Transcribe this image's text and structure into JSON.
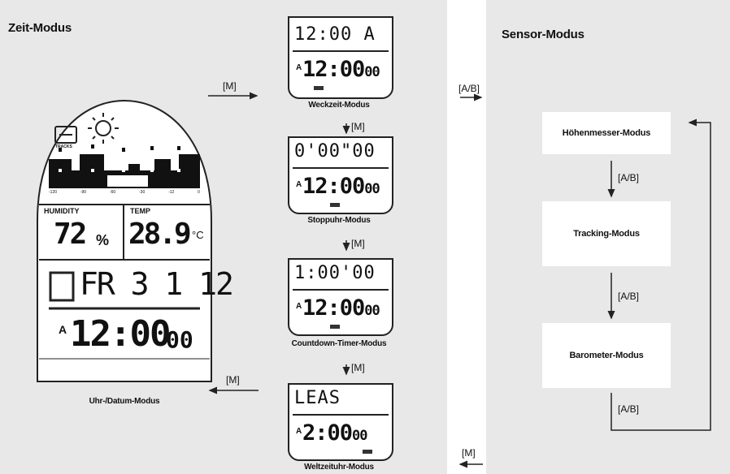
{
  "zeit": {
    "title": "Zeit-Modus",
    "main_caption": "Uhr-/Datum-Modus",
    "main_lcd": {
      "tracks_label": "TRACKS",
      "humidity_label": "HUMIDITY",
      "temp_label": "TEMP",
      "humidity_value": "72",
      "humidity_unit": "%",
      "temp_value": "28.9",
      "temp_unit": "°C",
      "date": "FR 3 1 12",
      "a_label": "A",
      "time": "12:00",
      "seconds": "00",
      "bar_axis": [
        "-120",
        "-90",
        "-60",
        "-30",
        "-12",
        "0"
      ]
    },
    "modes": [
      {
        "caption": "Weckzeit-Modus",
        "top": "12:00 A",
        "a_label": "A",
        "time": "12:00",
        "seconds": "00"
      },
      {
        "caption": "Stoppuhr-Modus",
        "top": "0'00\"00",
        "a_label": "A",
        "time": "12:00",
        "seconds": "00"
      },
      {
        "caption": "Countdown-Timer-Modus",
        "top": "1:00'00",
        "a_label": "A",
        "time": "12:00",
        "seconds": "00"
      },
      {
        "caption": "Weltzeituhr-Modus",
        "top": "LEAS",
        "a_label": "A",
        "time": "2:00",
        "seconds": "00"
      }
    ],
    "arrow_m_top": "[M]",
    "arrow_m_1": "[M]",
    "arrow_m_2": "[M]",
    "arrow_m_3": "[M]",
    "arrow_m_back": "[M]"
  },
  "center": {
    "ab_label": "[A/B]",
    "m_label": "[M]"
  },
  "sensor": {
    "title": "Sensor-Modus",
    "boxes": [
      "Höhenmesser-Modus",
      "Tracking-Modus",
      "Barometer-Modus"
    ],
    "ab_1": "[A/B]",
    "ab_2": "[A/B]",
    "ab_3": "[A/B]"
  }
}
